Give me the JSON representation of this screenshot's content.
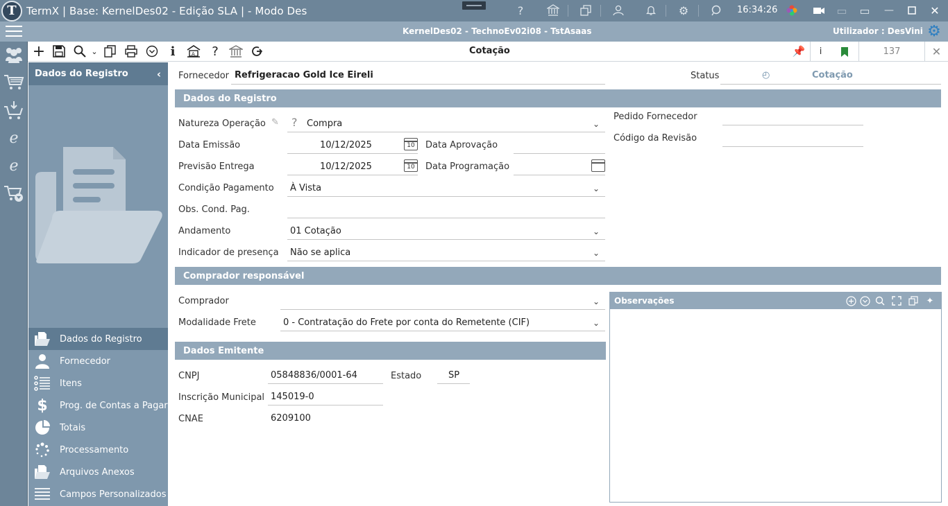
{
  "window": {
    "title": "TermX | Base: KernelDes02 - Edição SLA | - Modo Des",
    "clock": "16:34:26"
  },
  "session": {
    "info": "KernelDes02 - TechnoEv02i08 - TstAsaas",
    "user_label": "Utilizador :  DesVini"
  },
  "toolbar": {
    "title": "Cotação",
    "record_count": "137",
    "info_label": "i"
  },
  "sidepanel": {
    "title": "Dados do Registro",
    "items": [
      {
        "label": "Dados do Registro",
        "icon": "folder-open-icon",
        "active": true
      },
      {
        "label": "Fornecedor",
        "icon": "person-icon",
        "active": false
      },
      {
        "label": "Itens",
        "icon": "list-icon",
        "active": false
      },
      {
        "label": "Prog. de Contas a Pagar",
        "icon": "dollar-icon",
        "active": false
      },
      {
        "label": "Totais",
        "icon": "pie-chart-icon",
        "active": false
      },
      {
        "label": "Processamento",
        "icon": "spinner-icon",
        "active": false
      },
      {
        "label": "Arquivos Anexos",
        "icon": "folder-open-icon",
        "active": false
      },
      {
        "label": "Campos Personalizados",
        "icon": "list-lines-icon",
        "active": false
      }
    ]
  },
  "header": {
    "fornecedor_label": "Fornecedor",
    "fornecedor_value": "Refrigeracao Gold Ice Eireli",
    "status_label": "Status",
    "status_value": "Cotação"
  },
  "dados_registro": {
    "section_title": "Dados do Registro",
    "natureza_label": "Natureza Operação",
    "natureza_value": "Compra",
    "data_emissao_label": "Data Emissão",
    "data_emissao_value": "10/12/2025",
    "data_aprovacao_label": "Data Aprovação",
    "data_aprovacao_value": "",
    "previsao_label": "Previsão Entrega",
    "previsao_value": "10/12/2025",
    "data_programacao_label": "Data Programação",
    "data_programacao_value": "",
    "condicao_label": "Condição Pagamento",
    "condicao_value": "À Vista",
    "obs_cond_label": "Obs. Cond. Pag.",
    "obs_cond_value": "",
    "andamento_label": "Andamento",
    "andamento_value": "01 Cotação",
    "indicador_label": "Indicador de presença",
    "indicador_value": "Não se aplica",
    "pedido_label": "Pedido Fornecedor",
    "pedido_value": "",
    "codigo_revisao_label": "Código da Revisão",
    "codigo_revisao_value": "",
    "calendar_day": "10"
  },
  "comprador": {
    "section_title": "Comprador responsável",
    "comprador_label": "Comprador",
    "comprador_value": "",
    "modalidade_label": "Modalidade Frete",
    "modalidade_value": "0 - Contratação do Frete por conta do Remetente (CIF)"
  },
  "emitente": {
    "section_title": "Dados Emitente",
    "cnpj_label": "CNPJ",
    "cnpj_value": "05848836/0001-64",
    "estado_label": "Estado",
    "estado_value": "SP",
    "inscricao_label": "Inscrição Municipal",
    "inscricao_value": "145019-0",
    "cnae_label": "CNAE",
    "cnae_value": "6209100"
  },
  "observacoes": {
    "title": "Observações"
  }
}
